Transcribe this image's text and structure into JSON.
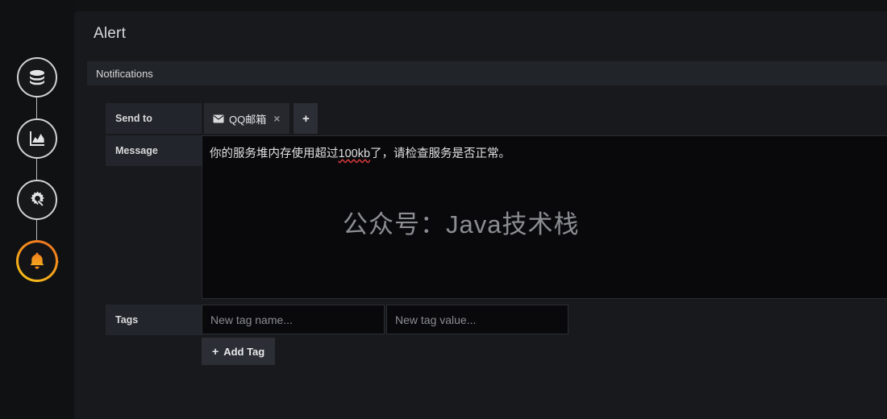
{
  "page": {
    "title": "Alert",
    "section_title": "Notifications"
  },
  "colors": {
    "panel_bg": "#18191c",
    "outer_bg": "#111214",
    "section_bar_bg": "#212429",
    "label_bg": "#22252b",
    "input_bg": "#09090b",
    "text": "#d8d9da",
    "accent_active_ring_start": "#f5c518",
    "accent_active_ring_end": "#ed6c20",
    "accent_bell": "#f0871f",
    "misspell_underline": "#e03c3c"
  },
  "sidebar": {
    "steps": [
      {
        "icon": "database-icon",
        "label": "Query",
        "active": false
      },
      {
        "icon": "graph-panel-icon",
        "label": "Visualization",
        "active": false
      },
      {
        "icon": "gear-wrench-icon",
        "label": "General",
        "active": false
      },
      {
        "icon": "bell-icon",
        "label": "Alert",
        "active": true
      }
    ]
  },
  "form": {
    "send_to": {
      "label": "Send to",
      "tags": [
        {
          "icon": "envelope-icon",
          "name": "QQ邮箱",
          "remove_label": "×"
        }
      ],
      "add_button_label": "+"
    },
    "message": {
      "label": "Message",
      "value_before": "你的服务堆内存使用超过",
      "value_misspelled": "100kb",
      "value_after": "了，请检查服务是否正常。",
      "full_value": "你的服务堆内存使用超过100kb了，请检查服务是否正常。",
      "watermark": "公众号：Java技术栈"
    },
    "tags": {
      "label": "Tags",
      "name_placeholder": "New tag name...",
      "name_value": "",
      "value_placeholder": "New tag value...",
      "value_value": "",
      "add_tag_label": "Add Tag",
      "add_tag_plus": "+"
    }
  }
}
